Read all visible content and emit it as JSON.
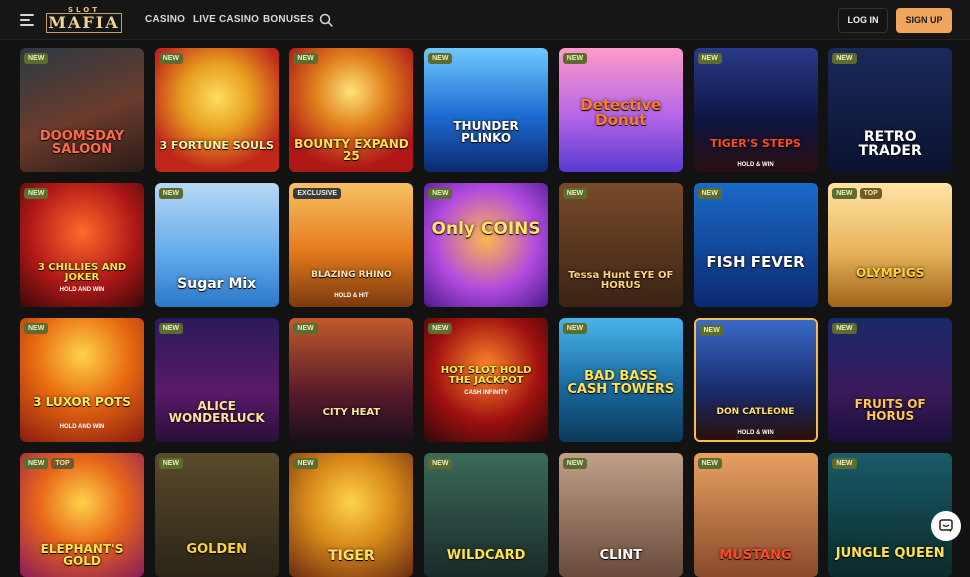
{
  "header": {
    "logo_top": "SLOT",
    "logo_main": "MAFIA",
    "nav": [
      "CASINO",
      "LIVE CASINO",
      "BONUSES"
    ],
    "login_label": "LOG IN",
    "signup_label": "SIGN UP",
    "menu_icon": "hamburger-menu-icon",
    "search_icon": "search-icon"
  },
  "games": [
    {
      "title": "DOOMSDAY SALOON",
      "badges": [
        "NEW"
      ]
    },
    {
      "title": "3 FORTUNE SOULS",
      "badges": [
        "NEW"
      ]
    },
    {
      "title": "BOUNTY EXPAND 25",
      "badges": [
        "NEW"
      ]
    },
    {
      "title": "THUNDER PLINKO",
      "badges": [
        "NEW"
      ]
    },
    {
      "title": "Detective Donut",
      "badges": [
        "NEW"
      ]
    },
    {
      "title": "TIGER'S STEPS",
      "sub": "HOLD & WIN",
      "badges": [
        "NEW"
      ]
    },
    {
      "title": "RETRO TRADER",
      "badges": [
        "NEW"
      ]
    },
    {
      "title": "3 CHILLIES AND JOKER",
      "sub": "HOLD AND WIN",
      "badges": [
        "NEW"
      ]
    },
    {
      "title": "Sugar Mix",
      "badges": [
        "NEW"
      ]
    },
    {
      "title": "BLAZING RHINO",
      "sub": "HOLD & HIT",
      "badges": [
        "EXCLUSIVE"
      ]
    },
    {
      "title": "Only COINS",
      "badges": [
        "NEW"
      ]
    },
    {
      "title": "Tessa Hunt EYE OF HORUS",
      "badges": [
        "NEW"
      ]
    },
    {
      "title": "FISH FEVER",
      "badges": [
        "NEW"
      ]
    },
    {
      "title": "OLYMPIGS",
      "badges": [
        "NEW",
        "TOP"
      ]
    },
    {
      "title": "3 LUXOR POTS",
      "sub": "HOLD AND WIN",
      "badges": [
        "NEW"
      ]
    },
    {
      "title": "ALICE WONDERLUCK",
      "badges": [
        "NEW"
      ]
    },
    {
      "title": "CITY HEAT",
      "badges": [
        "NEW"
      ]
    },
    {
      "title": "HOT SLOT HOLD THE JACKPOT",
      "sub": "CASH INFINITY",
      "badges": [
        "NEW"
      ]
    },
    {
      "title": "BAD BASS CASH TOWERS",
      "badges": [
        "NEW"
      ]
    },
    {
      "title": "DON CATLEONE",
      "sub": "HOLD & WIN",
      "badges": [
        "NEW"
      ]
    },
    {
      "title": "FRUITS OF HORUS",
      "badges": [
        "NEW"
      ]
    },
    {
      "title": "ELEPHANT'S GOLD",
      "badges": [
        "NEW",
        "TOP"
      ]
    },
    {
      "title": "GOLDEN",
      "badges": [
        "NEW"
      ]
    },
    {
      "title": "TIGER",
      "badges": [
        "NEW"
      ]
    },
    {
      "title": "WILDCARD",
      "badges": [
        "NEW"
      ]
    },
    {
      "title": "CLINT",
      "badges": [
        "NEW"
      ]
    },
    {
      "title": "MUSTANG",
      "badges": [
        "NEW"
      ]
    },
    {
      "title": "JUNGLE QUEEN",
      "badges": [
        "NEW"
      ]
    }
  ],
  "colors": {
    "background": "#121212",
    "header": "#161616",
    "accent": "#f1a65c",
    "new_badge": "#5e6b2f"
  },
  "chat_icon": "chat-bubble-icon"
}
